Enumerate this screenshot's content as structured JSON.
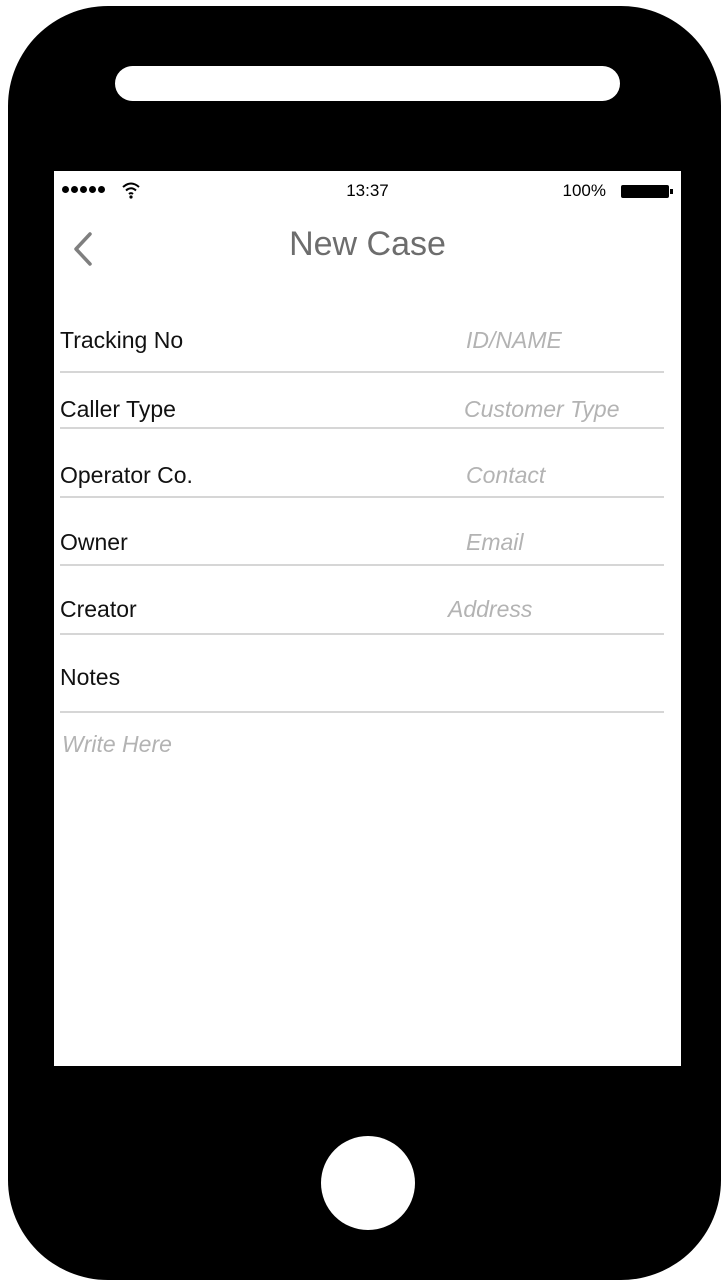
{
  "status_bar": {
    "signal_dots": 5,
    "time": "13:37",
    "battery_percent": "100%"
  },
  "nav": {
    "title": "New Case",
    "back_icon": "chevron-left-icon"
  },
  "form": {
    "fields": [
      {
        "label": "Tracking No",
        "placeholder": "ID/NAME"
      },
      {
        "label": "Caller Type",
        "placeholder": "Customer Type"
      },
      {
        "label": "Operator Co.",
        "placeholder": "Contact"
      },
      {
        "label": "Owner",
        "placeholder": "Email"
      },
      {
        "label": "Creator",
        "placeholder": "Address"
      }
    ],
    "notes_label": "Notes",
    "notes_placeholder": "Write Here"
  },
  "colors": {
    "device": "#000000",
    "screen": "#ffffff",
    "title": "#6d6d6d",
    "placeholder": "#b3b3b3",
    "divider": "#d6d6d6"
  }
}
